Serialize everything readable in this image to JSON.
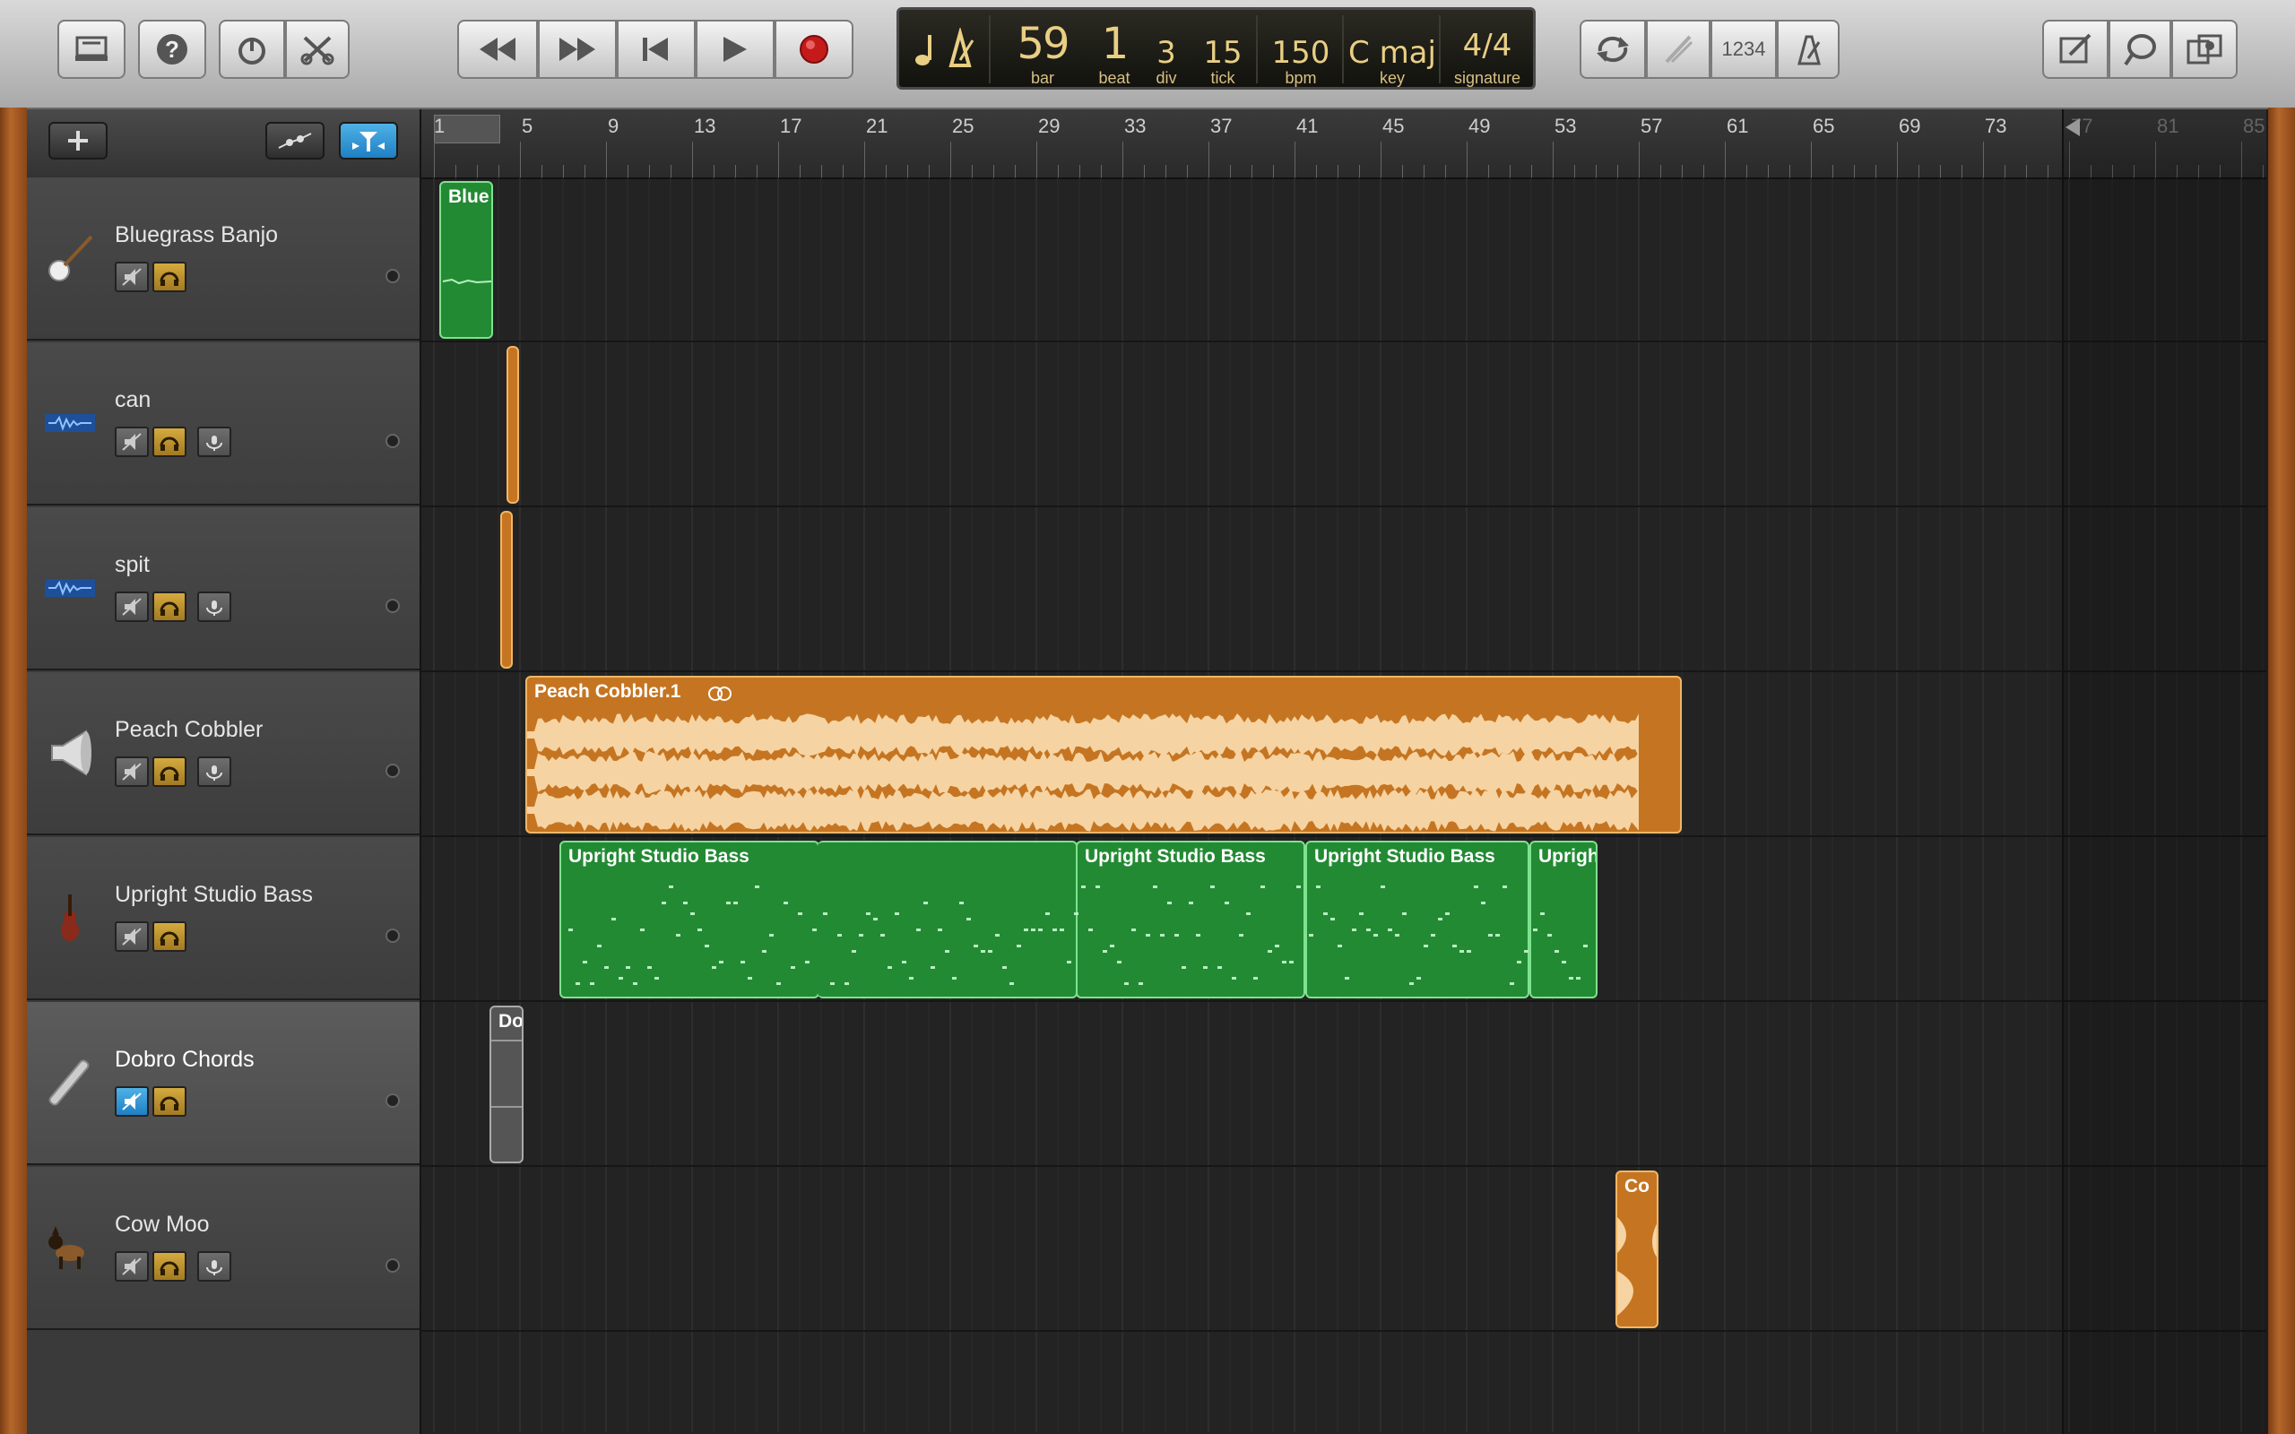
{
  "toolbar": {
    "left_buttons": [
      "library-icon",
      "help-icon",
      "smart-controls-icon",
      "editors-icon"
    ],
    "transport": [
      "rewind-icon",
      "fast-forward-icon",
      "go-to-beginning-icon",
      "play-icon",
      "record-icon"
    ],
    "right_buttons": [
      "cycle-icon",
      "tuner-icon",
      "count-in-icon",
      "metronome-icon"
    ],
    "count_in_label": "1234",
    "far_right": [
      "notepad-icon",
      "loop-browser-icon",
      "media-browser-icon"
    ]
  },
  "lcd": {
    "bar": "59",
    "bar_label": "bar",
    "beat": "1",
    "beat_label": "beat",
    "div": "3",
    "div_label": "div",
    "tick": "15",
    "tick_label": "tick",
    "bpm": "150",
    "bpm_label": "bpm",
    "key": "C maj",
    "key_label": "key",
    "signature": "4/4",
    "signature_label": "signature"
  },
  "ruler": [
    "1",
    "5",
    "9",
    "13",
    "17",
    "21",
    "25",
    "29",
    "33",
    "37",
    "41",
    "45",
    "49",
    "53",
    "57",
    "61",
    "65",
    "69",
    "73",
    "77",
    "81",
    "85"
  ],
  "tracks": [
    {
      "name": "Bluegrass Banjo",
      "icon": "banjo-icon",
      "muted": false,
      "monitor": false
    },
    {
      "name": "can",
      "icon": "audio-waveform-icon",
      "muted": false,
      "monitor": true
    },
    {
      "name": "spit",
      "icon": "audio-waveform-icon",
      "muted": false,
      "monitor": true
    },
    {
      "name": "Peach Cobbler",
      "icon": "speaker-icon",
      "muted": false,
      "monitor": true
    },
    {
      "name": "Upright Studio Bass",
      "icon": "upright-bass-icon",
      "muted": false,
      "monitor": false
    },
    {
      "name": "Dobro Chords",
      "icon": "slide-bar-icon",
      "muted": true,
      "monitor": false,
      "selected": true
    },
    {
      "name": "Cow Moo",
      "icon": "dog-icon",
      "muted": false,
      "monitor": true
    }
  ],
  "regions": {
    "banjo": "Blue",
    "peach": "Peach Cobbler.1",
    "bass1": "Upright Studio Bass",
    "bass2": "Upright Studio Bass",
    "bass3": "Upright Studio Bass",
    "bass4": "Uprigh",
    "dobro": "Do",
    "cow": "Co"
  }
}
